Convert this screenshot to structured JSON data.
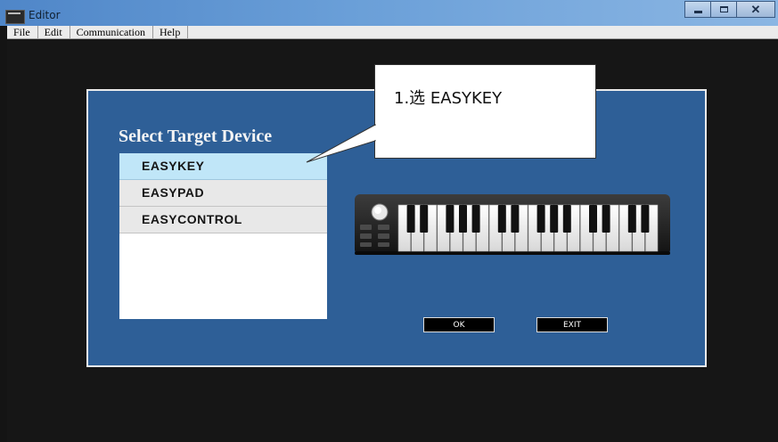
{
  "window": {
    "title": "Editor",
    "controls": [
      "minimize",
      "maximize",
      "close"
    ]
  },
  "menu": {
    "items": [
      "File",
      "Edit",
      "Communication",
      "Help"
    ]
  },
  "dialog": {
    "heading": "Select Target Device",
    "devices": [
      "EASYKEY",
      "EASYPAD",
      "EASYCONTROL"
    ],
    "selected_device": "EASYKEY",
    "ok_label": "OK",
    "exit_label": "EXIT"
  },
  "annotation": {
    "text": "1.选 EASYKEY"
  },
  "colors": {
    "panel": "#2e5f97",
    "selected_item": "#c0e6f8",
    "titlebar": "#6a9fd8"
  },
  "icons": {
    "app": "editor-app-icon",
    "device_preview": "midi-keyboard-image"
  }
}
